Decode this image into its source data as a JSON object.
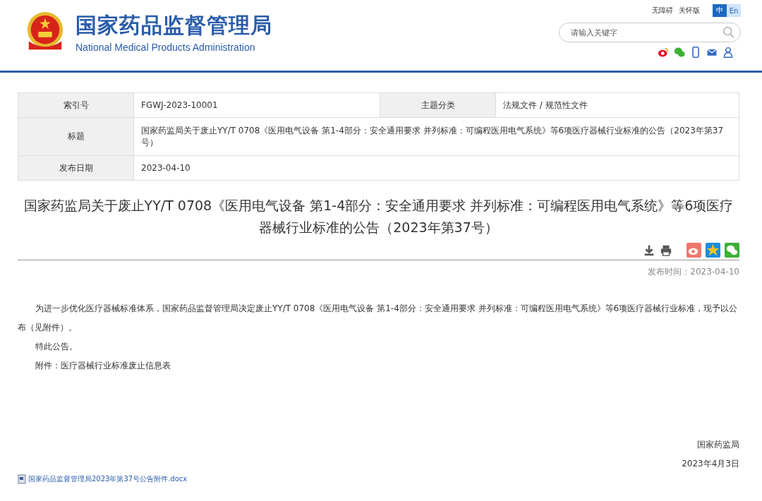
{
  "header": {
    "site_name": "国家药品监督管理局",
    "site_name_en": "National Medical Products Administration",
    "links": [
      "无障碍",
      "关怀版"
    ],
    "languages": [
      {
        "label": "中",
        "selected": true
      },
      {
        "label": "En",
        "selected": false
      }
    ],
    "search": {
      "placeholder": "请输入关键字"
    }
  },
  "meta_table": {
    "rows": [
      {
        "cells": [
          {
            "label": "索引号",
            "value": "FGWJ-2023-10001"
          },
          {
            "label": "主题分类",
            "value": "法规文件 / 规范性文件"
          }
        ]
      },
      {
        "cells": [
          {
            "label": "标题",
            "value": "国家药监局关于废止YY/T 0708《医用电气设备 第1-4部分：安全通用要求 并列标准：可编程医用电气系统》等6项医疗器械行业标准的公告（2023年第37号）"
          }
        ]
      },
      {
        "cells": [
          {
            "label": "发布日期",
            "value": "2023-04-10"
          }
        ]
      }
    ]
  },
  "article": {
    "title": "国家药监局关于废止YY/T 0708《医用电气设备 第1-4部分：安全通用要求 并列标准：可编程医用电气系统》等6项医疗器械行业标准的公告（2023年第37号）",
    "publish_time": "发布时间：2023-04-10",
    "paragraphs": [
      {
        "kind": "indent",
        "text": "为进一步优化医疗器械标准体系，国家药品监督管理局决定废止YY/T 0708《医用电气设备 第1-4部分：安全通用要求 并列标准：可编程医用电气系统》等6项医疗器械行业标准，现予以公布（见附件）。"
      },
      {
        "kind": "indent",
        "text": "特此公告。"
      },
      {
        "kind": "indent",
        "text": "附件：医疗器械行业标准废止信息表"
      }
    ],
    "signature": [
      "国家药监局",
      "2023年4月3日"
    ],
    "attachment": "国家药品监督管理局2023年第37号公告附件.docx"
  }
}
